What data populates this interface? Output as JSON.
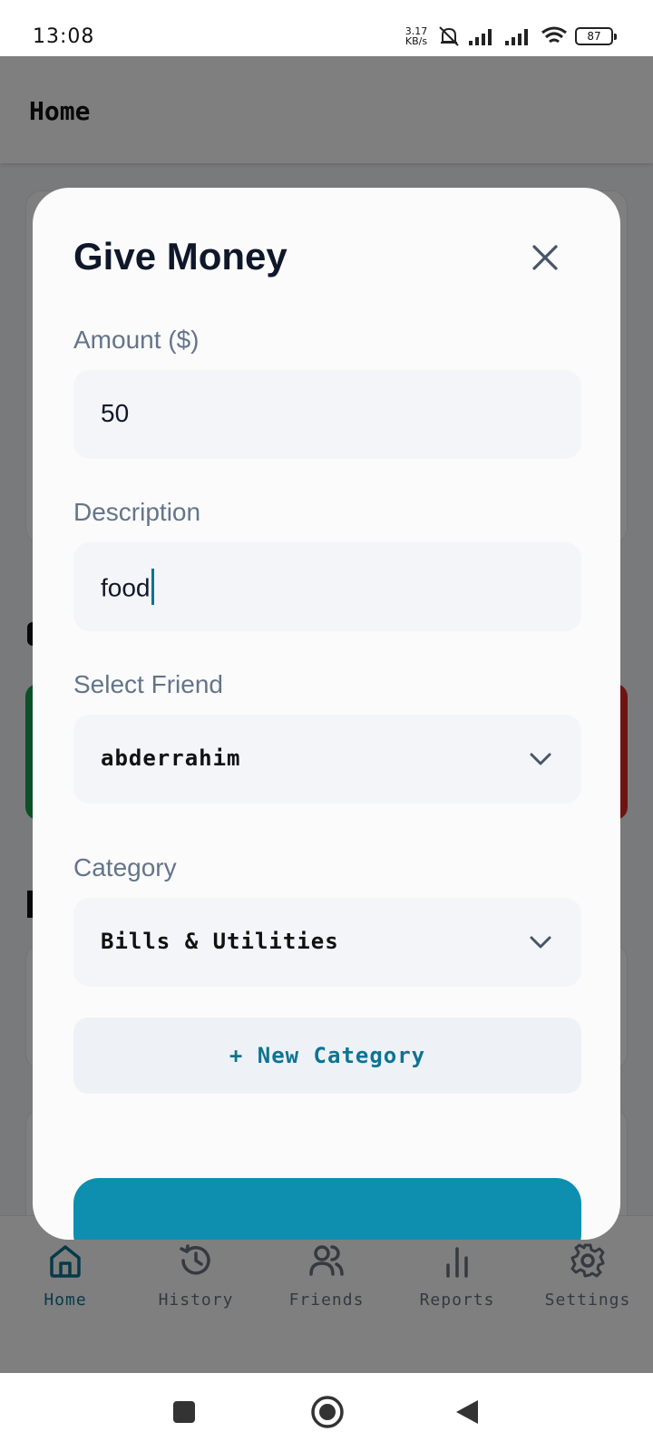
{
  "status_bar": {
    "time": "13:08",
    "net_speed_value": "3.17",
    "net_speed_unit": "KB/s",
    "battery": "87"
  },
  "app": {
    "title": "Home"
  },
  "bottom_nav": {
    "items": [
      {
        "label": "Home",
        "icon": "home-icon",
        "active": true
      },
      {
        "label": "History",
        "icon": "history-icon",
        "active": false
      },
      {
        "label": "Friends",
        "icon": "friends-icon",
        "active": false
      },
      {
        "label": "Reports",
        "icon": "reports-icon",
        "active": false
      },
      {
        "label": "Settings",
        "icon": "settings-icon",
        "active": false
      }
    ]
  },
  "modal": {
    "title": "Give Money",
    "amount": {
      "label": "Amount ($)",
      "value": "50"
    },
    "description": {
      "label": "Description",
      "value": "food"
    },
    "friend": {
      "label": "Select Friend",
      "value": "abderrahim"
    },
    "category": {
      "label": "Category",
      "value": "Bills & Utilities"
    },
    "new_category_label": "+ New Category"
  },
  "colors": {
    "accent": "#0e7490",
    "primary_button": "#0e8fb0",
    "income": "#16a34a",
    "expense": "#dc2626"
  }
}
